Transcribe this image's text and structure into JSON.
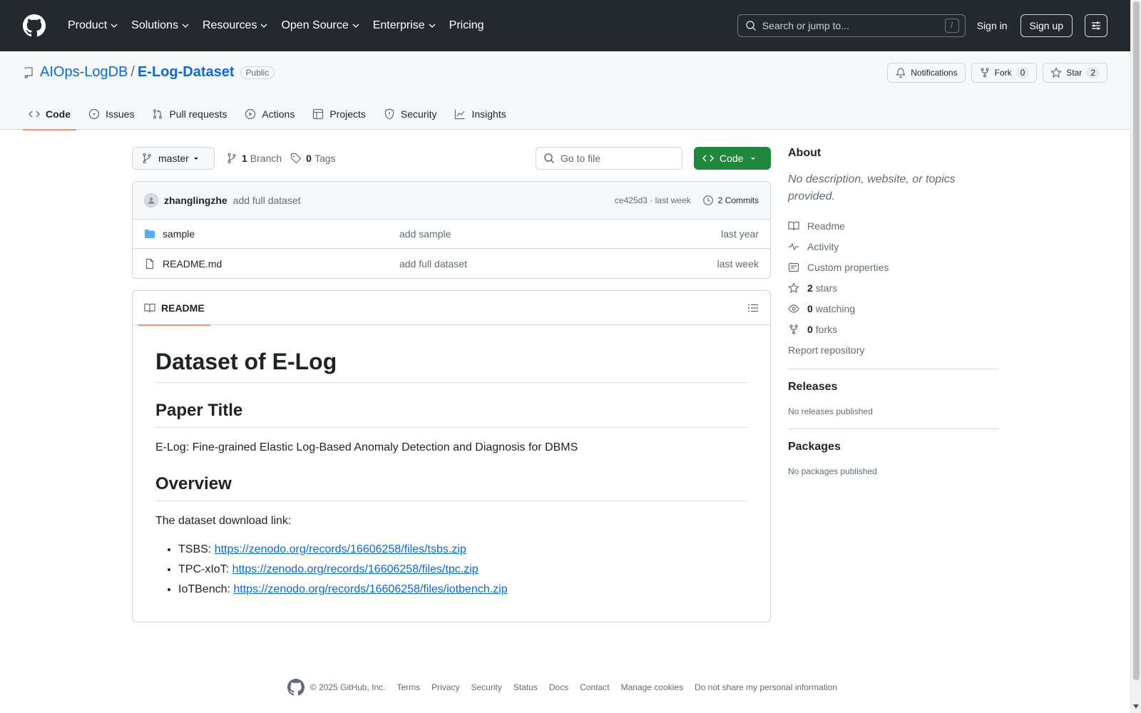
{
  "header": {
    "nav": [
      "Product",
      "Solutions",
      "Resources",
      "Open Source",
      "Enterprise",
      "Pricing"
    ],
    "search_placeholder": "Search or jump to...",
    "search_shortcut": "/",
    "signin": "Sign in",
    "signup": "Sign up"
  },
  "repo": {
    "owner": "AIOps-LogDB",
    "separator": "/",
    "name": "E-Log-Dataset",
    "visibility": "Public",
    "notifications": "Notifications",
    "fork_label": "Fork",
    "fork_count": "0",
    "star_label": "Star",
    "star_count": "2",
    "tabs": [
      "Code",
      "Issues",
      "Pull requests",
      "Actions",
      "Projects",
      "Security",
      "Insights"
    ]
  },
  "toolbar": {
    "branch": "master",
    "branch_count": "1",
    "branch_label": "Branch",
    "tag_count": "0",
    "tag_label": "Tags",
    "goto_placeholder": "Go to file",
    "code_label": "Code"
  },
  "commit": {
    "author": "zhanglingzhe",
    "message": "add full dataset",
    "sha_time": "ce425d3 · last week",
    "commits": "2 Commits"
  },
  "files": [
    {
      "name": "sample",
      "message": "add sample",
      "time": "last year",
      "type": "folder"
    },
    {
      "name": "README.md",
      "message": "add full dataset",
      "time": "last week",
      "type": "file"
    }
  ],
  "readme": {
    "tab": "README",
    "h1": "Dataset of E-Log",
    "h2_paper": "Paper Title",
    "paper_title": "E-Log: Fine-grained Elastic Log-Based Anomaly Detection and Diagnosis for DBMS",
    "h2_overview": "Overview",
    "download_intro": "The dataset download link:",
    "links": [
      {
        "label": "TSBS:",
        "url": "https://zenodo.org/records/16606258/files/tsbs.zip"
      },
      {
        "label": "TPC-xIoT:",
        "url": "https://zenodo.org/records/16606258/files/tpc.zip"
      },
      {
        "label": "IoTBench:",
        "url": "https://zenodo.org/records/16606258/files/iotbench.zip"
      }
    ]
  },
  "sidebar": {
    "about": "About",
    "description": "No description, website, or topics provided.",
    "readme": "Readme",
    "activity": "Activity",
    "custom_properties": "Custom properties",
    "stars_count": "2",
    "stars_label": "stars",
    "watching_count": "0",
    "watching_label": "watching",
    "forks_count": "0",
    "forks_label": "forks",
    "report": "Report repository",
    "releases": "Releases",
    "releases_none": "No releases published",
    "packages": "Packages",
    "packages_none": "No packages published"
  },
  "footer": {
    "copyright": "© 2025 GitHub, Inc.",
    "links": [
      "Terms",
      "Privacy",
      "Security",
      "Status",
      "Docs",
      "Contact",
      "Manage cookies",
      "Do not share my personal information"
    ]
  },
  "colors": {
    "header_bg": "#24292f",
    "accent_link": "#0969da",
    "code_button": "#1f883d",
    "tab_underline": "#fd8c73"
  }
}
